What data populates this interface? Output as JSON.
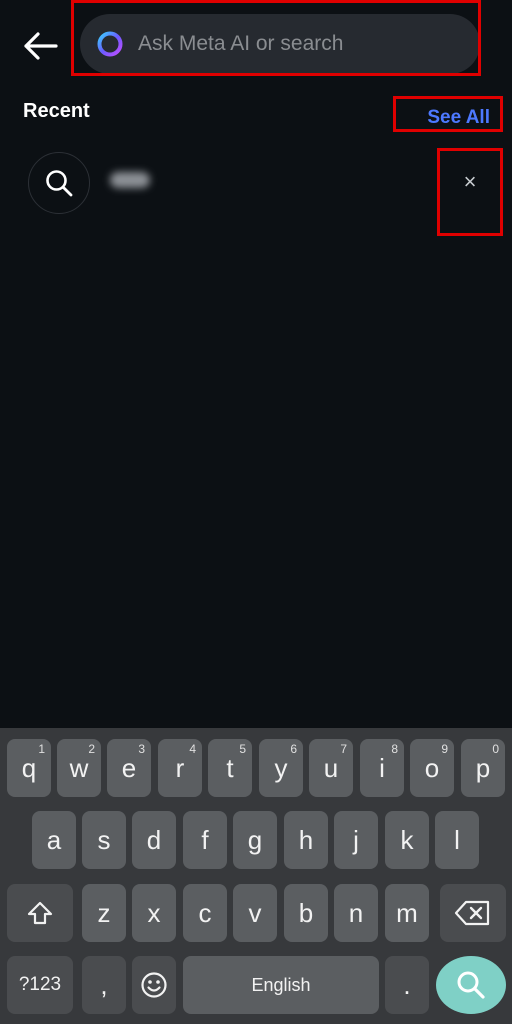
{
  "search": {
    "placeholder": "Ask Meta AI or search",
    "value": ""
  },
  "recent": {
    "title": "Recent",
    "see_all_label": "See All",
    "remove_label": "×"
  },
  "keyboard": {
    "row1": [
      {
        "char": "q",
        "hint": "1"
      },
      {
        "char": "w",
        "hint": "2"
      },
      {
        "char": "e",
        "hint": "3"
      },
      {
        "char": "r",
        "hint": "4"
      },
      {
        "char": "t",
        "hint": "5"
      },
      {
        "char": "y",
        "hint": "6"
      },
      {
        "char": "u",
        "hint": "7"
      },
      {
        "char": "i",
        "hint": "8"
      },
      {
        "char": "o",
        "hint": "9"
      },
      {
        "char": "p",
        "hint": "0"
      }
    ],
    "row2": [
      "a",
      "s",
      "d",
      "f",
      "g",
      "h",
      "j",
      "k",
      "l"
    ],
    "row3": [
      "z",
      "x",
      "c",
      "v",
      "b",
      "n",
      "m"
    ],
    "symbols_label": "?123",
    "comma_label": ",",
    "space_label": "English",
    "period_label": "."
  },
  "colors": {
    "background": "#0c1014",
    "accent_link": "#4d79ff",
    "highlight": "#e00000",
    "keyboard_bg": "#37393c",
    "key_bg": "#5b5e61",
    "enter_key": "#7fd0c6"
  },
  "icons": {
    "back": "arrow-left-icon",
    "meta_ai": "meta-ai-ring-icon",
    "search": "search-icon",
    "shift": "shift-icon",
    "backspace": "backspace-icon",
    "emoji": "emoji-icon",
    "enter_search": "search-icon"
  }
}
